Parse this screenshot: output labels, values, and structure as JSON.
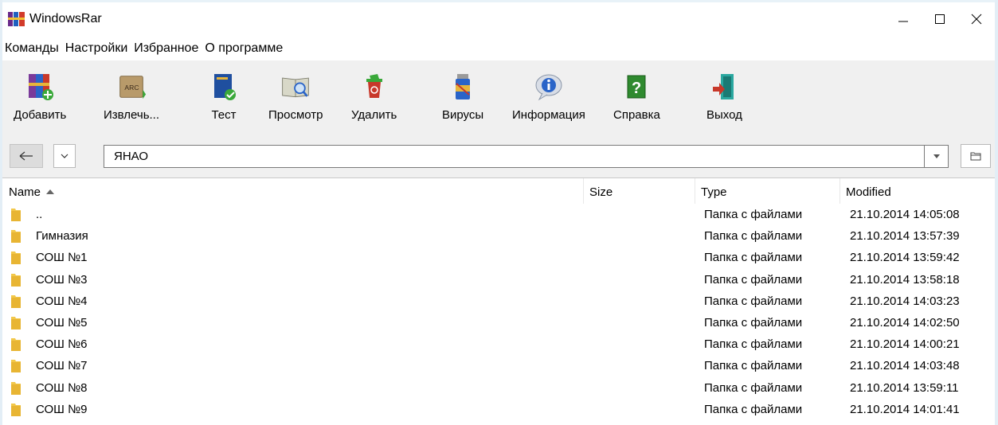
{
  "window": {
    "title": "WindowsRar",
    "accent_color": "#e8f2f8"
  },
  "title_controls": {
    "minimize_icon": "minimize-icon",
    "maximize_icon": "maximize-icon",
    "close_icon": "close-icon"
  },
  "menu": {
    "items": [
      {
        "label": "Команды"
      },
      {
        "label": "Настройки"
      },
      {
        "label": "Избранное"
      },
      {
        "label": "О программе"
      }
    ]
  },
  "toolbar": {
    "buttons": [
      {
        "label": "Добавить",
        "icon": "add-archive-icon"
      },
      {
        "label": "Извлечь...",
        "icon": "extract-icon"
      },
      {
        "label": "Тест",
        "icon": "test-icon"
      },
      {
        "label": "Просмотр",
        "icon": "view-icon"
      },
      {
        "label": "Удалить",
        "icon": "delete-icon"
      },
      {
        "label": "Вирусы",
        "icon": "virus-scan-icon"
      },
      {
        "label": "Информация",
        "icon": "info-icon"
      },
      {
        "label": "Справка",
        "icon": "help-icon"
      },
      {
        "label": "Выход",
        "icon": "exit-icon"
      }
    ]
  },
  "address": {
    "path": "ЯНАО"
  },
  "list": {
    "columns": {
      "name": "Name",
      "size": "Size",
      "type": "Type",
      "modified": "Modified"
    },
    "sort_column": "name",
    "sort_direction": "ascending",
    "rows": [
      {
        "name": "..",
        "size": "",
        "type": "Папка с файлами",
        "modified": "21.10.2014 14:05:08"
      },
      {
        "name": "Гимназия",
        "size": "",
        "type": "Папка с файлами",
        "modified": "21.10.2014 13:57:39"
      },
      {
        "name": "СОШ №1",
        "size": "",
        "type": "Папка с файлами",
        "modified": "21.10.2014 13:59:42"
      },
      {
        "name": "СОШ №3",
        "size": "",
        "type": "Папка с файлами",
        "modified": "21.10.2014 13:58:18"
      },
      {
        "name": "СОШ №4",
        "size": "",
        "type": "Папка с файлами",
        "modified": "21.10.2014 14:03:23"
      },
      {
        "name": "СОШ №5",
        "size": "",
        "type": "Папка с файлами",
        "modified": "21.10.2014 14:02:50"
      },
      {
        "name": "СОШ №6",
        "size": "",
        "type": "Папка с файлами",
        "modified": "21.10.2014 14:00:21"
      },
      {
        "name": "СОШ №7",
        "size": "",
        "type": "Папка с файлами",
        "modified": "21.10.2014 14:03:48"
      },
      {
        "name": "СОШ №8",
        "size": "",
        "type": "Папка с файлами",
        "modified": "21.10.2014 13:59:11"
      },
      {
        "name": "СОШ №9",
        "size": "",
        "type": "Папка с файлами",
        "modified": "21.10.2014 14:01:41"
      }
    ]
  }
}
